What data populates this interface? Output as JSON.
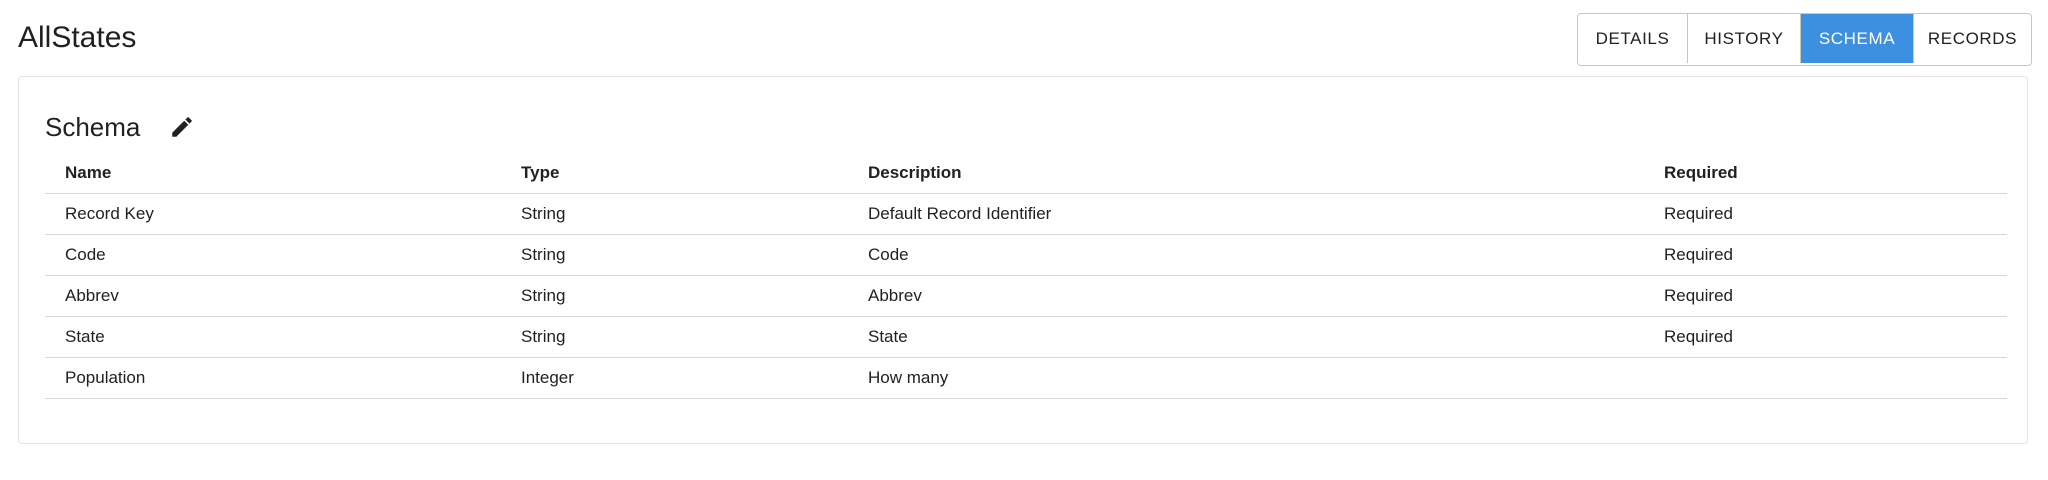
{
  "page": {
    "title": "AllStates"
  },
  "tabs": [
    {
      "label": "DETAILS",
      "active": false
    },
    {
      "label": "HISTORY",
      "active": false
    },
    {
      "label": "SCHEMA",
      "active": true
    },
    {
      "label": "RECORDS",
      "active": false
    }
  ],
  "schema": {
    "title": "Schema",
    "edit_icon": "pencil-icon",
    "columns": [
      "Name",
      "Type",
      "Description",
      "Required"
    ],
    "rows": [
      {
        "name": "Record Key",
        "type": "String",
        "description": "Default Record Identifier",
        "required": "Required"
      },
      {
        "name": "Code",
        "type": "String",
        "description": "Code",
        "required": "Required"
      },
      {
        "name": "Abbrev",
        "type": "String",
        "description": "Abbrev",
        "required": "Required"
      },
      {
        "name": "State",
        "type": "String",
        "description": "State",
        "required": "Required"
      },
      {
        "name": "Population",
        "type": "Integer",
        "description": "How many",
        "required": ""
      }
    ]
  },
  "colors": {
    "accent": "#3d8fe0",
    "text": "#212121",
    "border": "#d7d7d7"
  }
}
